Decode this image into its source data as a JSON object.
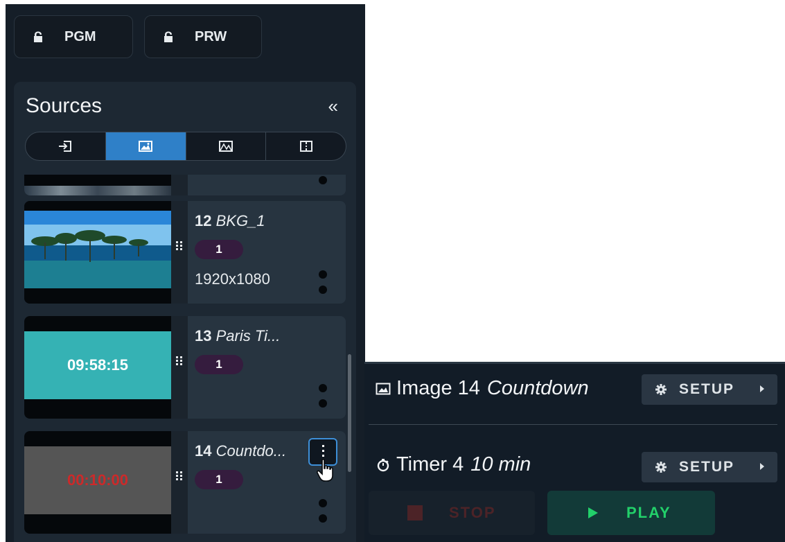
{
  "toolbar": {
    "pgm_label": "PGM",
    "prw_label": "PRW"
  },
  "sources": {
    "title": "Sources",
    "collapse_glyph": "«",
    "tabs": [
      {
        "icon": "input-icon",
        "active": false
      },
      {
        "icon": "image-icon",
        "active": true
      },
      {
        "icon": "overlay-image-icon",
        "active": false
      },
      {
        "icon": "split-layout-icon",
        "active": false
      }
    ],
    "items": [
      {
        "number": "12",
        "name": "BKG_1",
        "badge": "1",
        "resolution": "1920x1080",
        "thumb": "landscape"
      },
      {
        "number": "13",
        "name": "Paris Ti...",
        "badge": "1",
        "resolution": "",
        "thumb_time": "09:58:15",
        "thumb_color": "#35b2b4"
      },
      {
        "number": "14",
        "name": "Countdo...",
        "badge": "1",
        "resolution": "",
        "thumb_time": "00:10:00",
        "thumb_color": "#555555",
        "thumb_time_color": "#cc2a2a"
      }
    ]
  },
  "detail": {
    "image_label": "Image 14",
    "image_name": "Countdown",
    "timer_label": "Timer 4",
    "timer_value": "10 min",
    "setup_label": "SETUP",
    "stop_label": "STOP",
    "play_label": "PLAY"
  },
  "colors": {
    "accent": "#2f80c8",
    "play_green": "#22d06a",
    "stop_red": "#4c2327",
    "badge_purple": "#351c3e"
  }
}
